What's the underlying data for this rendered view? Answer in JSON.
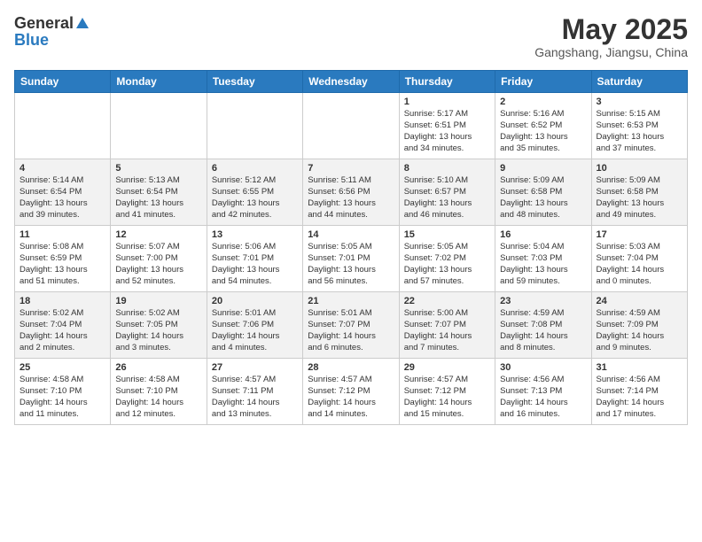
{
  "header": {
    "logo_general": "General",
    "logo_blue": "Blue",
    "month_year": "May 2025",
    "location": "Gangshang, Jiangsu, China"
  },
  "weekdays": [
    "Sunday",
    "Monday",
    "Tuesday",
    "Wednesday",
    "Thursday",
    "Friday",
    "Saturday"
  ],
  "weeks": [
    [
      {
        "day": "",
        "info": ""
      },
      {
        "day": "",
        "info": ""
      },
      {
        "day": "",
        "info": ""
      },
      {
        "day": "",
        "info": ""
      },
      {
        "day": "1",
        "info": "Sunrise: 5:17 AM\nSunset: 6:51 PM\nDaylight: 13 hours\nand 34 minutes."
      },
      {
        "day": "2",
        "info": "Sunrise: 5:16 AM\nSunset: 6:52 PM\nDaylight: 13 hours\nand 35 minutes."
      },
      {
        "day": "3",
        "info": "Sunrise: 5:15 AM\nSunset: 6:53 PM\nDaylight: 13 hours\nand 37 minutes."
      }
    ],
    [
      {
        "day": "4",
        "info": "Sunrise: 5:14 AM\nSunset: 6:54 PM\nDaylight: 13 hours\nand 39 minutes."
      },
      {
        "day": "5",
        "info": "Sunrise: 5:13 AM\nSunset: 6:54 PM\nDaylight: 13 hours\nand 41 minutes."
      },
      {
        "day": "6",
        "info": "Sunrise: 5:12 AM\nSunset: 6:55 PM\nDaylight: 13 hours\nand 42 minutes."
      },
      {
        "day": "7",
        "info": "Sunrise: 5:11 AM\nSunset: 6:56 PM\nDaylight: 13 hours\nand 44 minutes."
      },
      {
        "day": "8",
        "info": "Sunrise: 5:10 AM\nSunset: 6:57 PM\nDaylight: 13 hours\nand 46 minutes."
      },
      {
        "day": "9",
        "info": "Sunrise: 5:09 AM\nSunset: 6:58 PM\nDaylight: 13 hours\nand 48 minutes."
      },
      {
        "day": "10",
        "info": "Sunrise: 5:09 AM\nSunset: 6:58 PM\nDaylight: 13 hours\nand 49 minutes."
      }
    ],
    [
      {
        "day": "11",
        "info": "Sunrise: 5:08 AM\nSunset: 6:59 PM\nDaylight: 13 hours\nand 51 minutes."
      },
      {
        "day": "12",
        "info": "Sunrise: 5:07 AM\nSunset: 7:00 PM\nDaylight: 13 hours\nand 52 minutes."
      },
      {
        "day": "13",
        "info": "Sunrise: 5:06 AM\nSunset: 7:01 PM\nDaylight: 13 hours\nand 54 minutes."
      },
      {
        "day": "14",
        "info": "Sunrise: 5:05 AM\nSunset: 7:01 PM\nDaylight: 13 hours\nand 56 minutes."
      },
      {
        "day": "15",
        "info": "Sunrise: 5:05 AM\nSunset: 7:02 PM\nDaylight: 13 hours\nand 57 minutes."
      },
      {
        "day": "16",
        "info": "Sunrise: 5:04 AM\nSunset: 7:03 PM\nDaylight: 13 hours\nand 59 minutes."
      },
      {
        "day": "17",
        "info": "Sunrise: 5:03 AM\nSunset: 7:04 PM\nDaylight: 14 hours\nand 0 minutes."
      }
    ],
    [
      {
        "day": "18",
        "info": "Sunrise: 5:02 AM\nSunset: 7:04 PM\nDaylight: 14 hours\nand 2 minutes."
      },
      {
        "day": "19",
        "info": "Sunrise: 5:02 AM\nSunset: 7:05 PM\nDaylight: 14 hours\nand 3 minutes."
      },
      {
        "day": "20",
        "info": "Sunrise: 5:01 AM\nSunset: 7:06 PM\nDaylight: 14 hours\nand 4 minutes."
      },
      {
        "day": "21",
        "info": "Sunrise: 5:01 AM\nSunset: 7:07 PM\nDaylight: 14 hours\nand 6 minutes."
      },
      {
        "day": "22",
        "info": "Sunrise: 5:00 AM\nSunset: 7:07 PM\nDaylight: 14 hours\nand 7 minutes."
      },
      {
        "day": "23",
        "info": "Sunrise: 4:59 AM\nSunset: 7:08 PM\nDaylight: 14 hours\nand 8 minutes."
      },
      {
        "day": "24",
        "info": "Sunrise: 4:59 AM\nSunset: 7:09 PM\nDaylight: 14 hours\nand 9 minutes."
      }
    ],
    [
      {
        "day": "25",
        "info": "Sunrise: 4:58 AM\nSunset: 7:10 PM\nDaylight: 14 hours\nand 11 minutes."
      },
      {
        "day": "26",
        "info": "Sunrise: 4:58 AM\nSunset: 7:10 PM\nDaylight: 14 hours\nand 12 minutes."
      },
      {
        "day": "27",
        "info": "Sunrise: 4:57 AM\nSunset: 7:11 PM\nDaylight: 14 hours\nand 13 minutes."
      },
      {
        "day": "28",
        "info": "Sunrise: 4:57 AM\nSunset: 7:12 PM\nDaylight: 14 hours\nand 14 minutes."
      },
      {
        "day": "29",
        "info": "Sunrise: 4:57 AM\nSunset: 7:12 PM\nDaylight: 14 hours\nand 15 minutes."
      },
      {
        "day": "30",
        "info": "Sunrise: 4:56 AM\nSunset: 7:13 PM\nDaylight: 14 hours\nand 16 minutes."
      },
      {
        "day": "31",
        "info": "Sunrise: 4:56 AM\nSunset: 7:14 PM\nDaylight: 14 hours\nand 17 minutes."
      }
    ]
  ]
}
